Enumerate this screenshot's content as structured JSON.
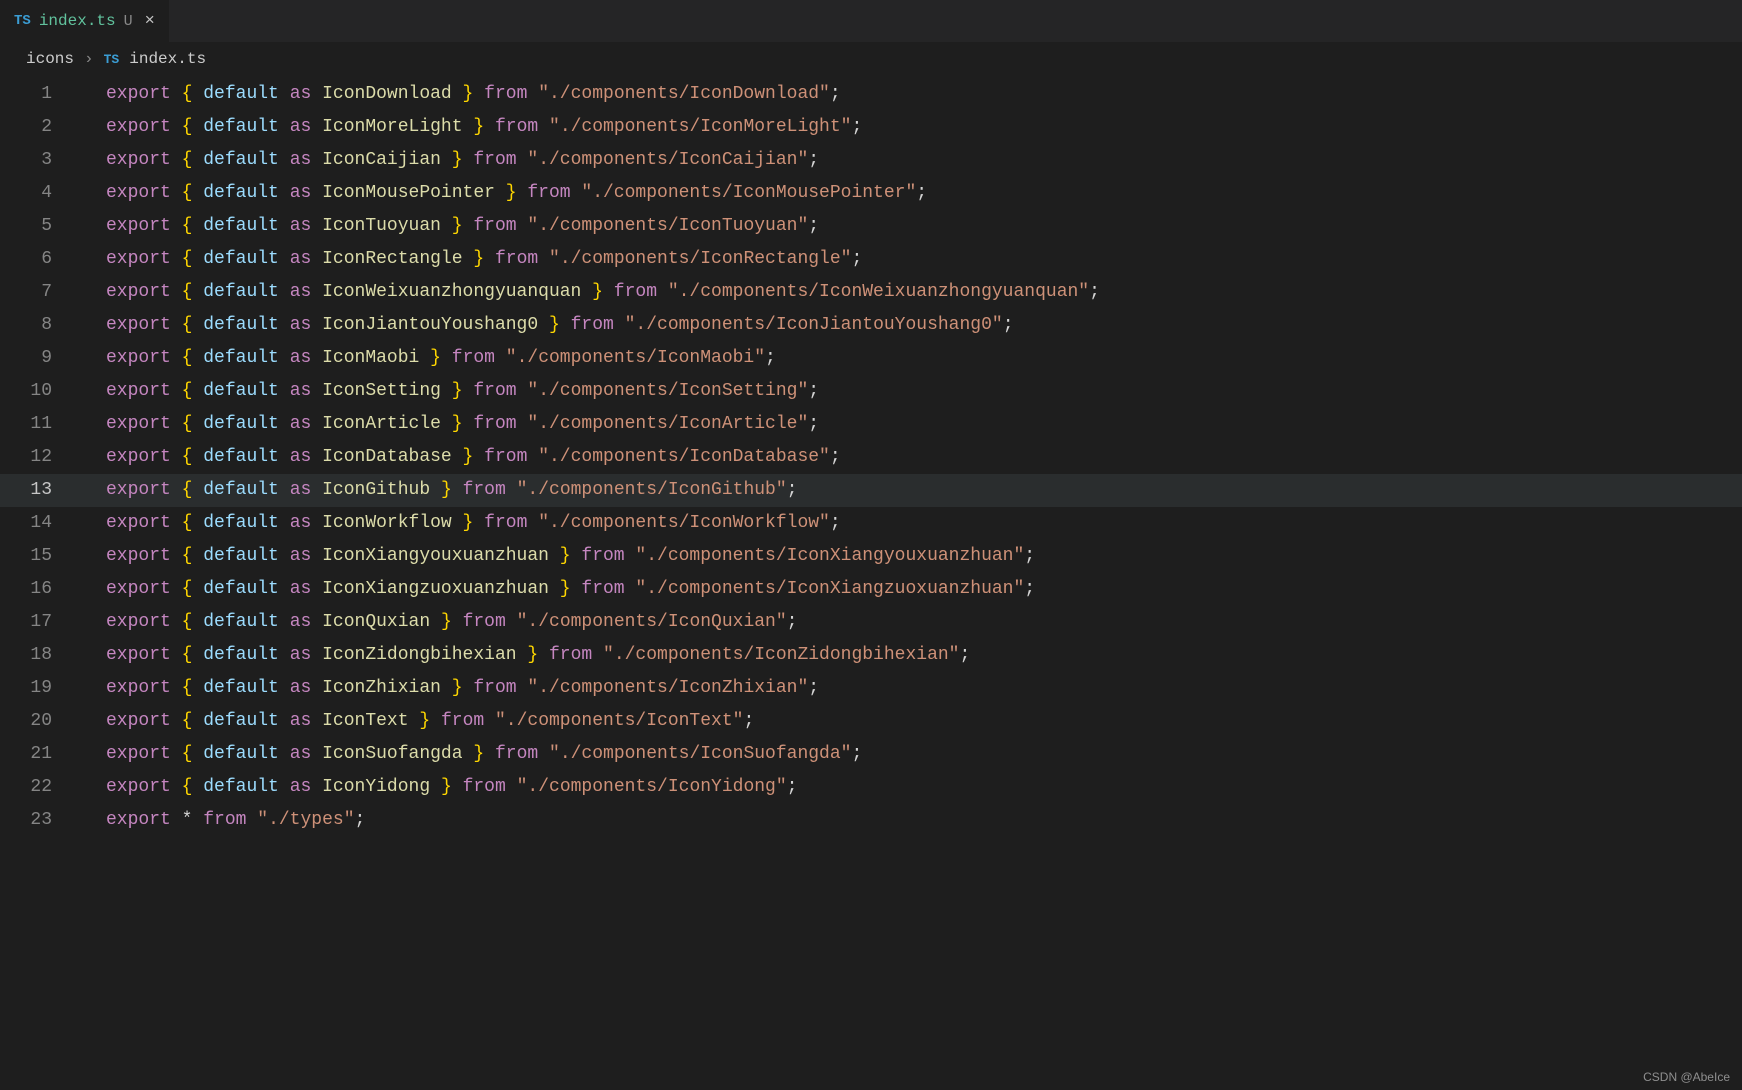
{
  "tab": {
    "icon": "TS",
    "label": "index.ts",
    "status": "U",
    "close": "×"
  },
  "breadcrumb": {
    "folder": "icons",
    "sep": "›",
    "icon": "TS",
    "file": "index.ts"
  },
  "syntax": {
    "export": "export",
    "default": "default",
    "as": "as",
    "from": "from",
    "lbrace": "{",
    "rbrace": "}",
    "semi": ";",
    "star": "*"
  },
  "lines": [
    {
      "n": 1,
      "id": "IconDownload",
      "path": "\"./components/IconDownload\""
    },
    {
      "n": 2,
      "id": "IconMoreLight",
      "path": "\"./components/IconMoreLight\""
    },
    {
      "n": 3,
      "id": "IconCaijian",
      "path": "\"./components/IconCaijian\""
    },
    {
      "n": 4,
      "id": "IconMousePointer",
      "path": "\"./components/IconMousePointer\""
    },
    {
      "n": 5,
      "id": "IconTuoyuan",
      "path": "\"./components/IconTuoyuan\""
    },
    {
      "n": 6,
      "id": "IconRectangle",
      "path": "\"./components/IconRectangle\""
    },
    {
      "n": 7,
      "id": "IconWeixuanzhongyuanquan",
      "path": "\"./components/IconWeixuanzhongyuanquan\""
    },
    {
      "n": 8,
      "id": "IconJiantouYoushang0",
      "path": "\"./components/IconJiantouYoushang0\""
    },
    {
      "n": 9,
      "id": "IconMaobi",
      "path": "\"./components/IconMaobi\""
    },
    {
      "n": 10,
      "id": "IconSetting",
      "path": "\"./components/IconSetting\""
    },
    {
      "n": 11,
      "id": "IconArticle",
      "path": "\"./components/IconArticle\""
    },
    {
      "n": 12,
      "id": "IconDatabase",
      "path": "\"./components/IconDatabase\""
    },
    {
      "n": 13,
      "id": "IconGithub",
      "path": "\"./components/IconGithub\"",
      "current": true
    },
    {
      "n": 14,
      "id": "IconWorkflow",
      "path": "\"./components/IconWorkflow\""
    },
    {
      "n": 15,
      "id": "IconXiangyouxuanzhuan",
      "path": "\"./components/IconXiangyouxuanzhuan\""
    },
    {
      "n": 16,
      "id": "IconXiangzuoxuanzhuan",
      "path": "\"./components/IconXiangzuoxuanzhuan\""
    },
    {
      "n": 17,
      "id": "IconQuxian",
      "path": "\"./components/IconQuxian\""
    },
    {
      "n": 18,
      "id": "IconZidongbihexian",
      "path": "\"./components/IconZidongbihexian\""
    },
    {
      "n": 19,
      "id": "IconZhixian",
      "path": "\"./components/IconZhixian\""
    },
    {
      "n": 20,
      "id": "IconText",
      "path": "\"./components/IconText\""
    },
    {
      "n": 21,
      "id": "IconSuofangda",
      "path": "\"./components/IconSuofangda\""
    },
    {
      "n": 22,
      "id": "IconYidong",
      "path": "\"./components/IconYidong\""
    }
  ],
  "lastLine": {
    "n": 23,
    "path": "\"./types\""
  },
  "watermark": "CSDN @AbeIce"
}
